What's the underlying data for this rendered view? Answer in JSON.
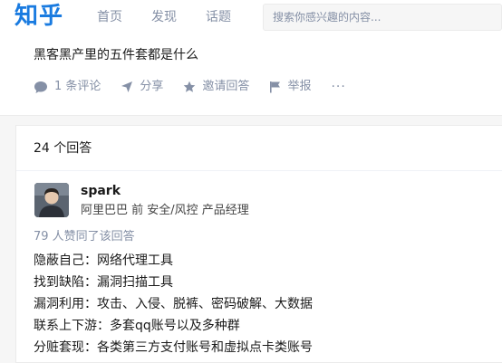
{
  "header": {
    "logo": "知乎",
    "nav": [
      "首页",
      "发现",
      "话题"
    ],
    "search_placeholder": "搜索你感兴趣的内容..."
  },
  "question": {
    "title": "黑客黑产里的五件套都是什么",
    "actions": {
      "comments": "1 条评论",
      "share": "分享",
      "invite": "邀请回答",
      "report": "举报",
      "more": "···"
    }
  },
  "answers": {
    "count_label": "24 个回答",
    "first": {
      "author": "spark",
      "bio": "阿里巴巴 前 安全/风控 产品经理",
      "voters": "79 人赞同了该回答",
      "lines": [
        "隐蔽自己：网络代理工具",
        "找到缺陷：漏洞扫描工具",
        "漏洞利用：攻击、入侵、脱裤、密码破解、大数据",
        "联系上下游：多套qq账号以及多种群",
        "分赃套现：各类第三方支付账号和虚拟点卡类账号"
      ]
    }
  },
  "colors": {
    "brand": "#1a7be0",
    "muted": "#8590a6",
    "background": "#f6f6f6"
  }
}
